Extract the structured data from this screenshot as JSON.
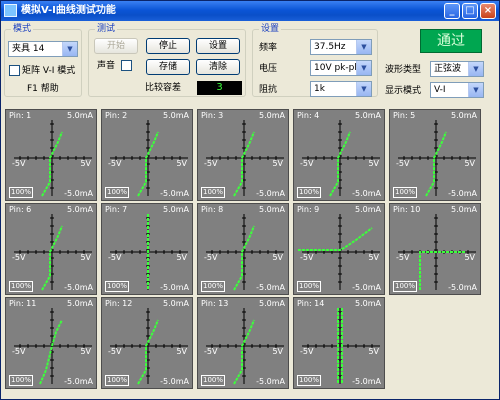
{
  "window": {
    "title": "模拟V-I曲线测试功能",
    "minimize": "_",
    "maximize": "□",
    "close": "×"
  },
  "mode": {
    "group_label": "模式",
    "fixture_value": "夹具 14",
    "matrix_label": "矩阵 V-I 模式",
    "help_label": "F1 帮助"
  },
  "test": {
    "group_label": "测试",
    "start_label": "开始",
    "stop_label": "停止",
    "settings_label": "设置",
    "sound_label": "声音",
    "save_label": "存储",
    "clear_label": "清除",
    "tolerance_label": "比较容差",
    "tolerance_value": "3"
  },
  "settings": {
    "group_label": "设置",
    "frequency_label": "频率",
    "frequency_value": "37.5Hz",
    "voltage_label": "电压",
    "voltage_value": "10V pk-pk",
    "impedance_label": "阻抗",
    "impedance_value": "1k",
    "waveform_label": "波形类型",
    "waveform_value": "正弦波",
    "display_label": "显示模式",
    "display_value": "V-I"
  },
  "result": {
    "status": "通过",
    "status_color": "#00a650"
  },
  "plot_axes": {
    "top": "5.0mA",
    "bottom": "-5.0mA",
    "left": "-5V",
    "right": "5V",
    "zoom": "100%"
  },
  "curve_color": "#3cff3c",
  "pins": [
    {
      "label": "Pin: 1",
      "curve": "diode_rev"
    },
    {
      "label": "Pin: 2",
      "curve": "diode_rev"
    },
    {
      "label": "Pin: 3",
      "curve": "diode_rev"
    },
    {
      "label": "Pin: 4",
      "curve": "diode_rev"
    },
    {
      "label": "Pin: 5",
      "curve": "diode_rev"
    },
    {
      "label": "Pin: 6",
      "curve": "diode_rev"
    },
    {
      "label": "Pin: 7",
      "curve": "open"
    },
    {
      "label": "Pin: 8",
      "curve": "diode_rev"
    },
    {
      "label": "Pin: 9",
      "curve": "diode_fwd"
    },
    {
      "label": "Pin: 10",
      "curve": "ground"
    },
    {
      "label": "Pin: 11",
      "curve": "resistor"
    },
    {
      "label": "Pin: 12",
      "curve": "diode_rev"
    },
    {
      "label": "Pin: 13",
      "curve": "diode_rev"
    },
    {
      "label": "Pin: 14",
      "curve": "short"
    }
  ]
}
